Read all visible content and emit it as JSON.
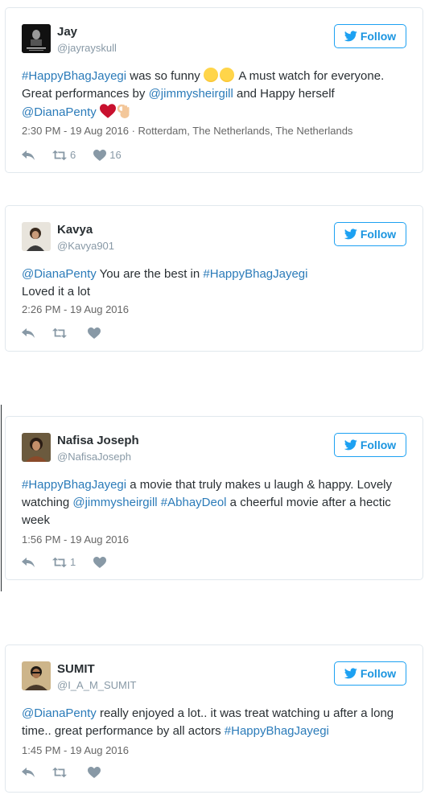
{
  "tweets": [
    {
      "name": "Jay",
      "handle": "@jayrayskull",
      "follow_label": "Follow",
      "text": {
        "p1": "#HappyBhagJayegi",
        "p2": " was so funny ",
        "p3": " A must watch for everyone. Great performances by ",
        "p4": "@jimmysheirgill",
        "p5": " and Happy herself ",
        "p6": "@DianaPenty"
      },
      "timestamp": "2:30 PM - 19 Aug 2016 · Rotterdam, The Netherlands, The Netherlands",
      "retweets": "6",
      "likes": "16"
    },
    {
      "name": "Kavya",
      "handle": "@Kavya901",
      "follow_label": "Follow",
      "text": {
        "p1": "@DianaPenty",
        "p2": " You are the best in ",
        "p3": "#HappyBhagJayegi",
        "p4": "Loved it a lot"
      },
      "timestamp": "2:26 PM - 19 Aug 2016",
      "retweets": "",
      "likes": ""
    },
    {
      "name": "Nafisa Joseph",
      "handle": "@NafisaJoseph",
      "follow_label": "Follow",
      "text": {
        "p1": "#HappyBhagJayegi",
        "p2": " a movie that truly makes u laugh & happy. Lovely watching ",
        "p3": "@jimmysheirgill",
        "p4": " ",
        "p5": "#AbhayDeol",
        "p6": " a cheerful movie after a hectic week"
      },
      "timestamp": "1:56 PM - 19 Aug 2016",
      "retweets": "1",
      "likes": ""
    },
    {
      "name": "SUMIT",
      "handle": "@I_A_M_SUMIT",
      "follow_label": "Follow",
      "text": {
        "p1": "@DianaPenty",
        "p2": " really enjoyed a lot.. it was treat watching u after a long time.. great performance by all actors ",
        "p3": "#HappyBhagJayegi"
      },
      "timestamp": "1:45 PM - 19 Aug 2016",
      "retweets": "",
      "likes": ""
    }
  ]
}
